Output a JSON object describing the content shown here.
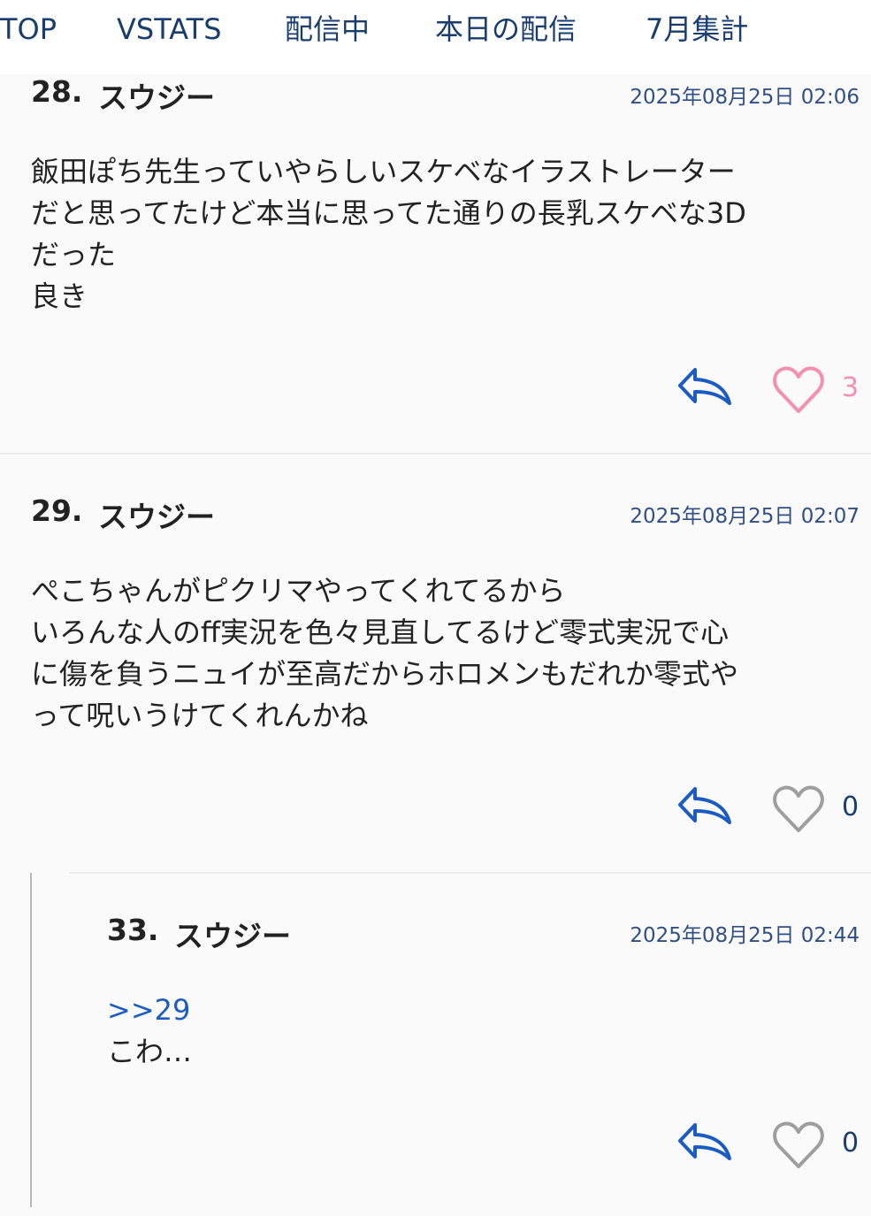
{
  "nav": {
    "items": [
      {
        "label": "TOP"
      },
      {
        "label": "VSTATS"
      },
      {
        "label": "配信中"
      },
      {
        "label": "本日の配信"
      },
      {
        "label": "7月集計"
      }
    ]
  },
  "comments": [
    {
      "number": "28.",
      "name": "スウジー",
      "date": "2025年08月25日 02:06",
      "body": "飯田ぽち先生っていやらしいスケベなイラストレーター\nだと思ってたけど本当に思ってた通りの長乳スケベな3D\nだった\n良き",
      "likes": "3"
    },
    {
      "number": "29.",
      "name": "スウジー",
      "date": "2025年08月25日 02:07",
      "body": "ぺこちゃんがピクリマやってくれてるから\nいろんな人のff実況を色々見直してるけど零式実況で心\nに傷を負うニュイが至高だからホロメンもだれか零式や\nって呪いうけてくれんかね",
      "likes": "0"
    },
    {
      "number": "33.",
      "name": "スウジー",
      "date": "2025年08月25日 02:44",
      "anchor": ">>29",
      "body": "こわ…",
      "likes": "0"
    }
  ],
  "colors": {
    "nav_text": "#1a3d6f",
    "date_text": "#2f4f86",
    "reply_icon": "#1d5bc4",
    "like_active": "#f48fb1",
    "like_inactive": "#9e9e9e",
    "count_inactive": "#1a3d6f"
  },
  "icons": {
    "reply": "reply-arrow-icon",
    "like": "heart-outline-icon"
  }
}
